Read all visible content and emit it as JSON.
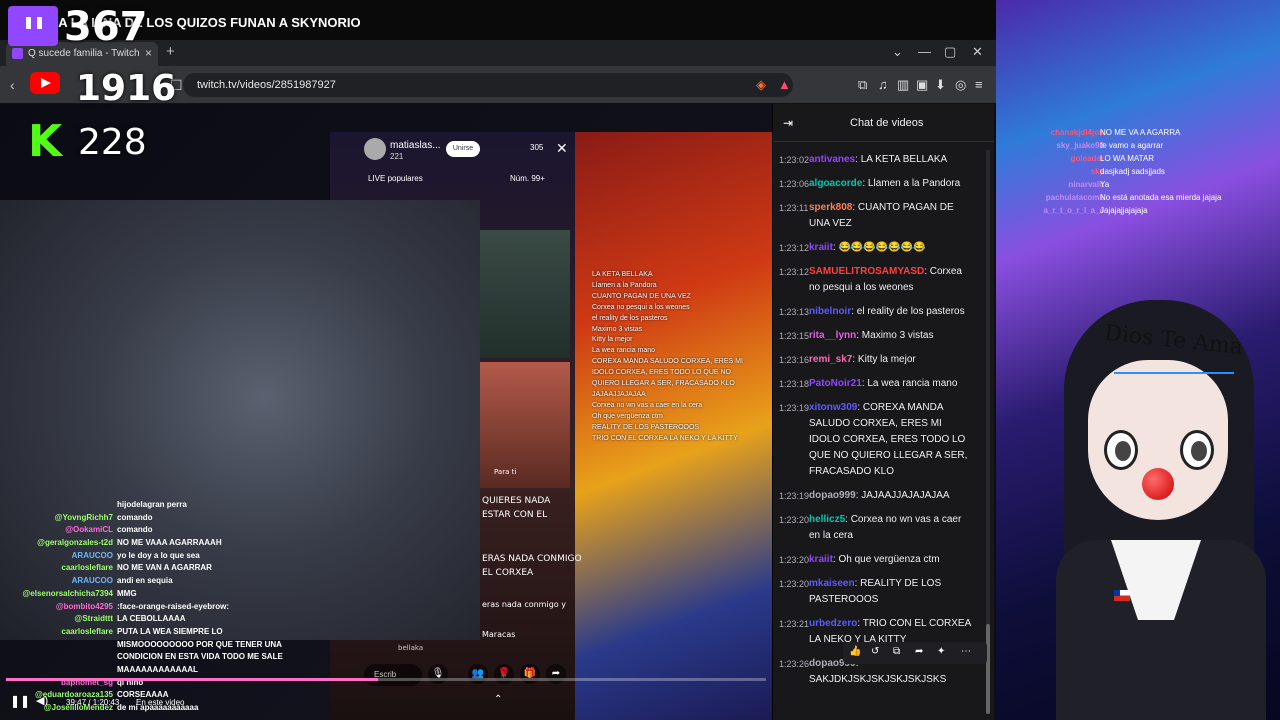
{
  "stream_title": "CORXEA LA LINA DE LOS QUIZOS FUNAN A SKYNORIO",
  "browser": {
    "tab_label": "Q sucede familia - Twitch",
    "new_tab": "+",
    "url": "twitch.tv/videos/2851987927",
    "window_controls": [
      "⌄",
      "—",
      "▢",
      "✕"
    ]
  },
  "counters": {
    "twitch": "367",
    "youtube": "1916",
    "kick": "228"
  },
  "tiktok": {
    "username": "matiaslas...",
    "follower_count": "221",
    "follow_label": "Unirse",
    "viewers": "305",
    "live_label": "LIVE populares",
    "rank": "Núm. 99+",
    "input_placeholder": "Escrib",
    "bellaka": "bellaka"
  },
  "video_overlay_text": {
    "quieres_nada": "QUIERES NADA",
    "estar_con": "ESTAR CON EL",
    "ras_nada": "ERAS NADA CONMIGO",
    "el_corxea": "EL CORXEA",
    "eras_nada_lower": "eras nada conmigo y",
    "maracas": "Maracas",
    "para_ti": "Para ti",
    "bellaka_overlay": "bellaka"
  },
  "mini_chat": [
    "LA KETA BELLAKA",
    "Llamen a la Pandora",
    "CUANTO PAGAN DE UNA VEZ",
    "",
    "Corxea no pesqui a los weones",
    "el reality de los pasteros",
    "Maximo 3 vistas",
    "Kitty la mejor",
    "La wea rancia mano",
    "COREXA MANDA SALUDO CORXEA, ERES MI",
    "IDOLO CORXEA, ERES TODO LO QUE NO",
    "QUIERO LLEGAR A SER, FRACASADO KLO",
    "JAJAAJJAJAJAA",
    "Corxea no wn vas a caer en la cera",
    "Oh que vergüenza ctm",
    "REALITY DE LOS PASTEROOOS",
    "TRIO CON EL CORXEA LA NEKO Y LA KITTY"
  ],
  "overlay_chat": [
    {
      "user": "",
      "msg": "hijodelagran perra",
      "color": "#ffffff"
    },
    {
      "user": "@YovngRichh7",
      "msg": "comando",
      "color": "#9dff6b"
    },
    {
      "user": "@OokamiCL",
      "msg": "comando",
      "color": "#ff6bd5"
    },
    {
      "user": "@geralgonzales-t2d",
      "msg": "NO ME VAAA AGARRAAAH",
      "color": "#9dff6b"
    },
    {
      "user": "ARAUCOO",
      "msg": "yo le doy a lo que sea",
      "color": "#6bb7ff"
    },
    {
      "user": "caarlosleflare",
      "msg": "NO ME VAN A AGARRAR",
      "color": "#9dff6b"
    },
    {
      "user": "ARAUCOO",
      "msg": "andi en sequia",
      "color": "#6bb7ff"
    },
    {
      "user": "@elsenorsalchicha7394",
      "msg": "MMG",
      "color": "#9dff6b"
    },
    {
      "user": "@bombito4295",
      "msg": ":face-orange-raised-eyebrow:",
      "color": "#ff6bd5"
    },
    {
      "user": "@Straidttt",
      "msg": "LA CEBOLLAAAA",
      "color": "#9dff6b"
    },
    {
      "user": "caarlosleflare",
      "msg": "PUTA LA WEA SIEMPRE LO",
      "color": "#9dff6b"
    },
    {
      "user": "",
      "msg": "MISMOOOOOOOOO POR QUE TENER UNA",
      "color": "#ffffff"
    },
    {
      "user": "",
      "msg": "CONDICION EN ESTA VIDA TODO ME SALE",
      "color": "#ffffff"
    },
    {
      "user": "",
      "msg": "MAAAAAAAAAAAAL",
      "color": "#ffffff"
    },
    {
      "user": "baphomet_sg",
      "msg": "ql nino",
      "color": "#ff6bd5"
    },
    {
      "user": "@eduardoaroaza135",
      "msg": "CORSEAAAA",
      "color": "#9dff6b"
    },
    {
      "user": "@JoselilloMendez",
      "msg": "de mi apaaaaaaaaaaa",
      "color": "#9dff6b"
    }
  ],
  "player": {
    "time": "39:47 / 1:20:43",
    "live_label": "En este video",
    "progress": 0.49
  },
  "chat": {
    "title": "Chat de videos",
    "messages": [
      {
        "ts": "1:23:02",
        "user": "antivanes",
        "color": "#9146ff",
        "text": ": LA KETA BELLAKA"
      },
      {
        "ts": "1:23:06",
        "user": "algoacorde",
        "color": "#00c8af",
        "text": ": Llamen a la Pandora"
      },
      {
        "ts": "1:23:11",
        "user": "sperk808",
        "color": "#ff7f50",
        "text": ": CUANTO PAGAN DE UNA VEZ"
      },
      {
        "ts": "1:23:12",
        "user": "kraiit",
        "color": "#9146ff",
        "text": ": 😂😂😂😂😂😂😂"
      },
      {
        "ts": "1:23:12",
        "user": "SAMUELITROSAMYASD",
        "color": "#ff4040",
        "text": ": Corxea no pesqui a los weones"
      },
      {
        "ts": "1:23:13",
        "user": "nibelnoir",
        "color": "#5b5bff",
        "text": ": el reality de los pasteros"
      },
      {
        "ts": "1:23:15",
        "user": "rita__lynn",
        "color": "#e060e0",
        "text": ": Maximo 3 vistas"
      },
      {
        "ts": "1:23:16",
        "user": "remi_sk7",
        "color": "#ff69b4",
        "text": ": Kitty la mejor"
      },
      {
        "ts": "1:23:18",
        "user": "PatoNoir21",
        "color": "#9146ff",
        "text": ": La wea rancia mano"
      },
      {
        "ts": "1:23:19",
        "user": "xitonw309",
        "color": "#5b5bff",
        "text": ": COREXA MANDA SALUDO CORXEA, ERES MI IDOLO CORXEA, ERES TODO LO QUE NO QUIERO LLEGAR A SER, FRACASADO KLO"
      },
      {
        "ts": "1:23:19",
        "user": "dopao999",
        "color": "#adadb8",
        "text": ": JAJAAJJAJAJAJAA"
      },
      {
        "ts": "1:23:20",
        "user": "hellicz5",
        "color": "#00c8af",
        "text": ": Corxea no wn vas a caer en la cera"
      },
      {
        "ts": "1:23:20",
        "user": "kraiit",
        "color": "#9146ff",
        "text": ": Oh que vergüenza ctm"
      },
      {
        "ts": "1:23:20",
        "user": "mkaiseen",
        "color": "#5b5bff",
        "text": ": REALITY DE LOS PASTEROOOS"
      },
      {
        "ts": "1:23:21",
        "user": "urbedzero",
        "color": "#5b5bff",
        "text": ": TRIO CON EL CORXEA LA NEKO Y LA KITTY"
      },
      {
        "ts": "1:23:26",
        "user": "",
        "color": "#adadb8",
        "text": ""
      },
      {
        "ts": "",
        "user": "dopao999",
        "color": "#adadb8",
        "text": ": SAKJDKJSKJSKJSKJSKJSKS"
      }
    ]
  },
  "vtuber": {
    "sign": "Dios Te Ama",
    "chat": [
      {
        "user": "chanakjdl4jon",
        "msg": "NO ME VA A AGARRA",
        "color": "#ff5577"
      },
      {
        "user": "sky_juako93",
        "msg": "te vamo a agarrar",
        "color": "#c08cff"
      },
      {
        "user": "goleader",
        "msg": "LO WA MATAR",
        "color": "#ff5577"
      },
      {
        "user": "sky",
        "msg": "dasjkadj sadsjjads",
        "color": "#ff5577"
      },
      {
        "user": "ninarvalit",
        "msg": "Ya",
        "color": "#c08cff"
      },
      {
        "user": "pachulatacome",
        "msg": "No está anotada esa mierda jajaja",
        "color": "#c08cff"
      },
      {
        "user": "a_r_t_o_r_l_a_s",
        "msg": "Jajajajjajajaja",
        "color": "#c08cff"
      }
    ]
  },
  "colors": {
    "twitch_purple": "#9146ff",
    "youtube_red": "#ff0000",
    "kick_green": "#53fc18",
    "chat_bg": "#18181b"
  }
}
